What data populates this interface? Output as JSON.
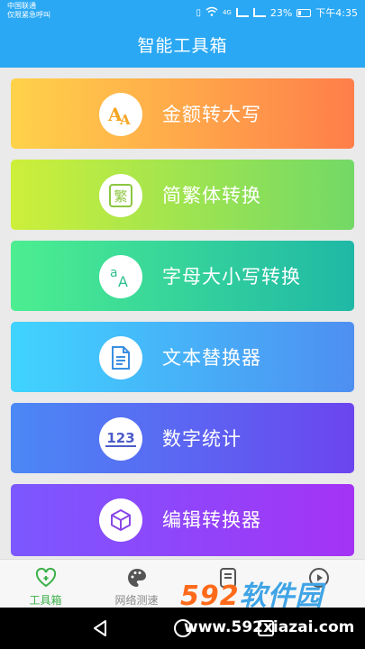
{
  "status_bar": {
    "carrier_line1": "中国联通",
    "carrier_line2": "仅限紧急呼叫",
    "battery_percent": "23%",
    "time": "下午4:35",
    "signal_label": "4G"
  },
  "app_bar": {
    "title": "智能工具箱"
  },
  "tools": [
    {
      "label": "金额转大写",
      "icon": "amount-uppercase-icon",
      "colors": [
        "#ffd24a",
        "#ff7e4a"
      ]
    },
    {
      "label": "简繁体转换",
      "icon": "traditional-chinese-icon",
      "icon_text": "繁",
      "colors": [
        "#cdef3a",
        "#72d966"
      ]
    },
    {
      "label": "字母大小写转换",
      "icon": "letter-case-icon",
      "colors": [
        "#4cee90",
        "#1fb8a6"
      ]
    },
    {
      "label": "文本替换器",
      "icon": "document-icon",
      "colors": [
        "#40d4ff",
        "#4e8ff1"
      ]
    },
    {
      "label": "数字统计",
      "icon": "number-count-icon",
      "icon_text": "123",
      "colors": [
        "#4b88f5",
        "#6b45ef"
      ]
    },
    {
      "label": "编辑转换器",
      "icon": "cube-icon",
      "colors": [
        "#7b58ff",
        "#a433f5"
      ]
    }
  ],
  "tab_bar": {
    "tabs": [
      {
        "label": "工具箱",
        "icon": "toolbox-heart-icon",
        "active": true
      },
      {
        "label": "网络测速",
        "icon": "palette-icon",
        "active": false
      },
      {
        "label": "",
        "icon": "list-icon",
        "active": false
      },
      {
        "label": "",
        "icon": "play-icon",
        "active": false
      }
    ],
    "active_color": "#3bb04a"
  },
  "watermark": {
    "brand_num": "592",
    "brand_cn": "软件园",
    "url": "www.592xiazai.com"
  }
}
